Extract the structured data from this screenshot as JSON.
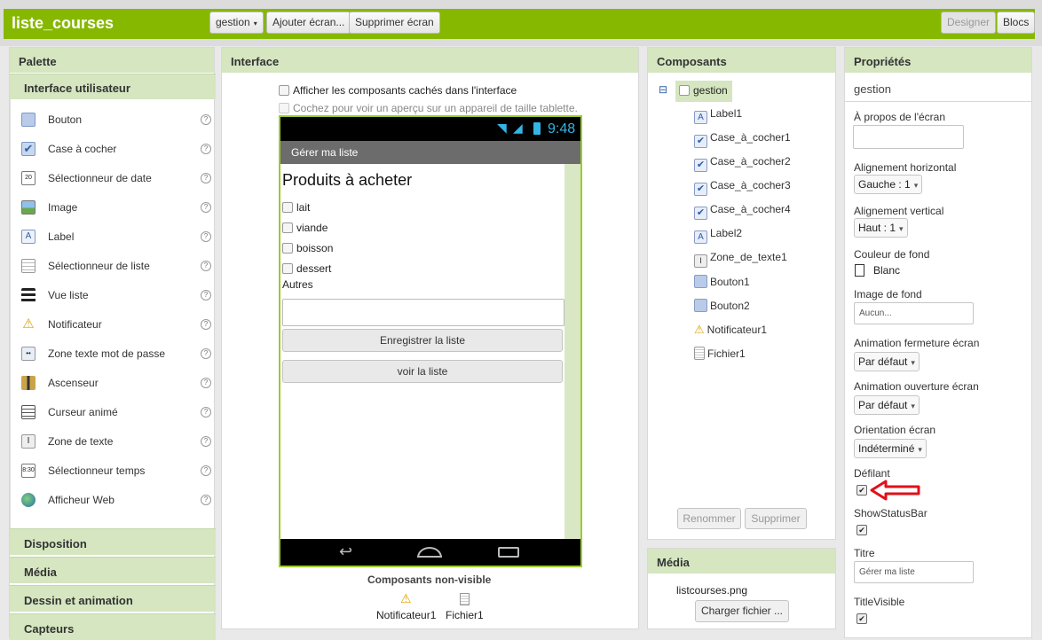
{
  "app": {
    "title": "liste_courses"
  },
  "toolbar": {
    "screen_select": "gestion",
    "add_screen": "Ajouter écran...",
    "remove_screen": "Supprimer écran",
    "designer": "Designer",
    "blocks": "Blocs"
  },
  "palette": {
    "title": "Palette",
    "category": "Interface utilisateur",
    "items": [
      {
        "label": "Bouton",
        "icon": "button-icon"
      },
      {
        "label": "Case à cocher",
        "icon": "checkbox-icon"
      },
      {
        "label": "Sélectionneur de date",
        "icon": "date-picker-icon"
      },
      {
        "label": "Image",
        "icon": "image-icon"
      },
      {
        "label": "Label",
        "icon": "label-icon"
      },
      {
        "label": "Sélectionneur de liste",
        "icon": "list-picker-icon"
      },
      {
        "label": "Vue liste",
        "icon": "list-view-icon"
      },
      {
        "label": "Notificateur",
        "icon": "notifier-icon"
      },
      {
        "label": "Zone texte mot de passe",
        "icon": "password-icon"
      },
      {
        "label": "Ascenseur",
        "icon": "slider-icon"
      },
      {
        "label": "Curseur animé",
        "icon": "spinner-icon"
      },
      {
        "label": "Zone de texte",
        "icon": "textbox-icon"
      },
      {
        "label": "Sélectionneur temps",
        "icon": "time-picker-icon"
      },
      {
        "label": "Afficheur Web",
        "icon": "web-viewer-icon"
      }
    ],
    "help": "?",
    "categories": [
      "Disposition",
      "Média",
      "Dessin et animation",
      "Capteurs"
    ]
  },
  "viewer": {
    "title": "Interface",
    "show_hidden": "Afficher les composants cachés dans l'interface",
    "tablet_preview": "Cochez pour voir un aperçu sur un appareil de taille tablette.",
    "status_time": "9:48",
    "phone_title": "Gérer ma liste",
    "heading": "Produits à acheter",
    "checkboxes": [
      "lait",
      "viande",
      "boisson",
      "dessert"
    ],
    "others_label": "Autres",
    "save_button": "Enregistrer la liste",
    "view_button": "voir la liste",
    "non_visible_title": "Composants non-visible",
    "non_visible": [
      "Notificateur1",
      "Fichier1"
    ]
  },
  "components": {
    "title": "Composants",
    "root": "gestion",
    "collapse": "⊟",
    "items": [
      "Label1",
      "Case_à_cocher1",
      "Case_à_cocher2",
      "Case_à_cocher3",
      "Case_à_cocher4",
      "Label2",
      "Zone_de_texte1",
      "Bouton1",
      "Bouton2",
      "Notificateur1",
      "Fichier1"
    ],
    "rename": "Renommer",
    "delete": "Supprimer"
  },
  "media": {
    "title": "Média",
    "file": "listcourses.png",
    "upload": "Charger fichier ..."
  },
  "properties": {
    "title": "Propriétés",
    "component": "gestion",
    "about_label": "À propos de l'écran",
    "halign_label": "Alignement horizontal",
    "halign_value": "Gauche : 1",
    "valign_label": "Alignement vertical",
    "valign_value": "Haut : 1",
    "bgcolor_label": "Couleur de fond",
    "bgcolor_value": "Blanc",
    "bgimage_label": "Image de fond",
    "bgimage_value": "Aucun...",
    "close_anim_label": "Animation fermeture écran",
    "close_anim_value": "Par défaut",
    "open_anim_label": "Animation ouverture écran",
    "open_anim_value": "Par défaut",
    "orientation_label": "Orientation écran",
    "orientation_value": "Indéterminé",
    "scrollable_label": "Défilant",
    "statusbar_label": "ShowStatusBar",
    "title_label": "Titre",
    "title_value": "Gérer ma liste",
    "title_visible_label": "TitleVisible"
  },
  "colors": {
    "accent": "#86b800",
    "header": "#d5e6c0",
    "annotation": "#e0101a"
  }
}
